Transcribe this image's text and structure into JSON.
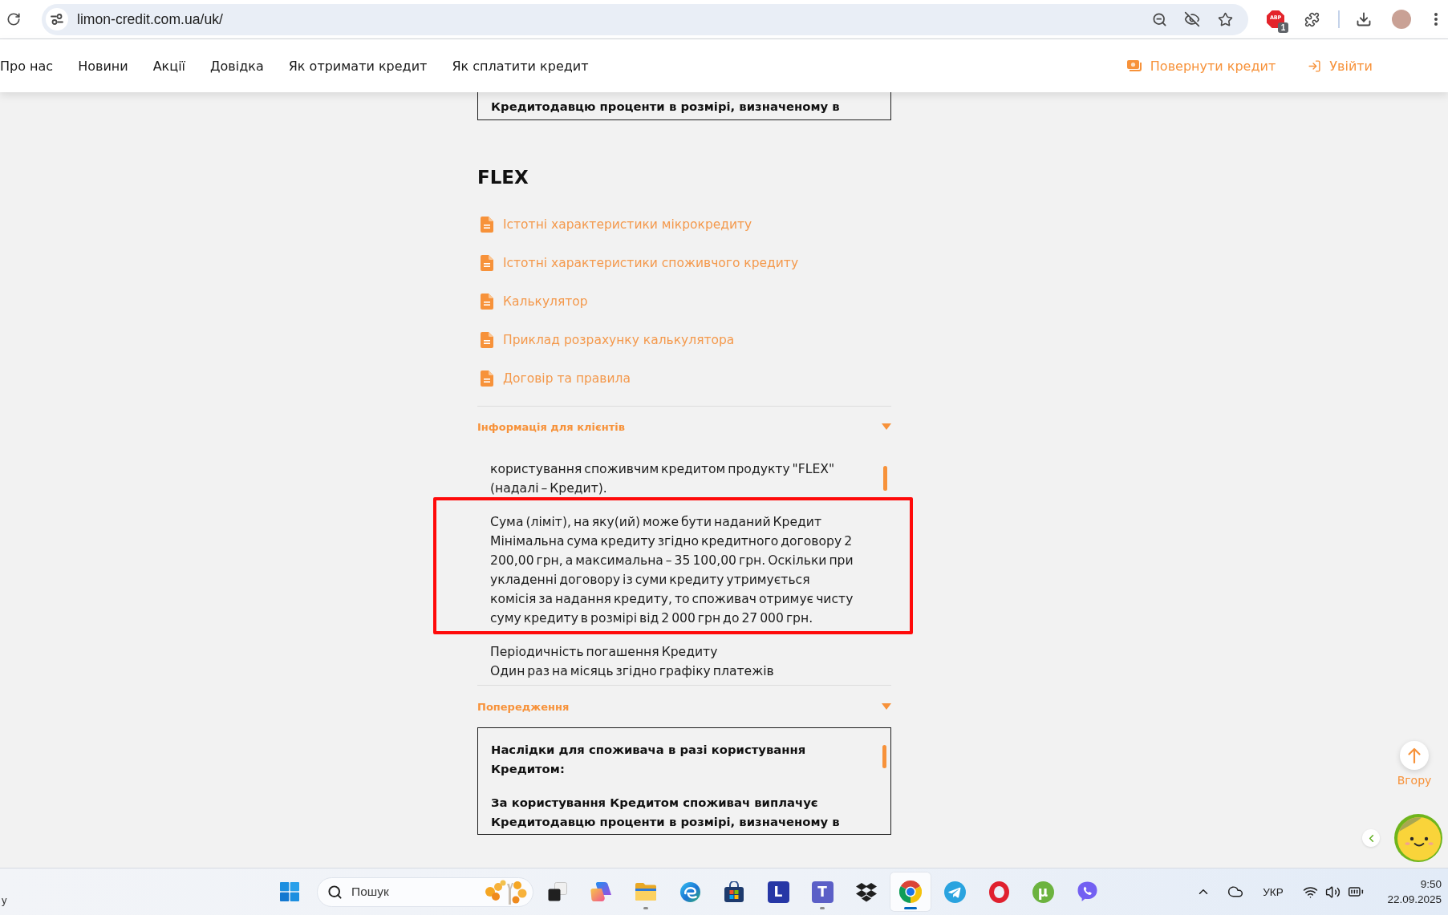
{
  "browser": {
    "url": "limon-credit.com.ua/uk/",
    "extension_label": "ABP",
    "extension_badge": "1"
  },
  "nav": {
    "items": [
      {
        "label": "Про нас"
      },
      {
        "label": "Новини"
      },
      {
        "label": "Акції"
      },
      {
        "label": "Довідка"
      },
      {
        "label": "Як отримати кредит"
      },
      {
        "label": "Як сплатити кредит"
      }
    ],
    "actions": [
      {
        "kind": "repay",
        "label": "Повернути кредит"
      },
      {
        "kind": "login",
        "label": "Увійти"
      }
    ]
  },
  "previous_box": {
    "text": "Кредитодавцю проценти в розмірі, визначеному в"
  },
  "product": {
    "title": "FLEX",
    "documents": [
      {
        "label": "Істотні характеристики мікрокредиту"
      },
      {
        "label": "Істотні характеристики споживчого кредиту"
      },
      {
        "label": "Калькулятор"
      },
      {
        "label": "Приклад розрахунку калькулятора"
      },
      {
        "label": "Договір та правила"
      }
    ]
  },
  "info_section": {
    "title": "Інформація для клієнтів",
    "expanded": true,
    "items": [
      {
        "text": "користування споживчим кредитом продукту \"FLEX\" (надалі – Кредит).",
        "highlighted": false
      },
      {
        "title": "Сума (ліміт), на яку(ий) може бути наданий Кредит",
        "text": "Мінімальна сума кредиту згідно кредитного договору 2 200,00 грн, а максимальна – 35 100,00 грн. Оскільки при укладенні договору із суми кредиту утримується комісія за надання кредиту, то споживач отримує чисту суму кредиту в розмірі від 2 000 грн до 27 000 грн.",
        "highlighted": true
      },
      {
        "title": "Періодичність погашення Кредиту",
        "text": "Один раз на місяць згідно графіку платежів",
        "highlighted": false
      }
    ]
  },
  "warning_section": {
    "title": "Попередження",
    "expanded": true,
    "paragraphs": [
      "Наслідки для споживача в разі користування Кредитом:",
      "За користування Кредитом споживач виплачує Кредитодавцю проценти в розмірі, визначеному в"
    ]
  },
  "scroll_top": {
    "label": "Вгору"
  },
  "taskbar": {
    "widget_text": "у",
    "search": {
      "placeholder": "Пошук"
    },
    "apps": [
      {
        "kind": "task-view",
        "running": false,
        "selected": false
      },
      {
        "kind": "copilot",
        "running": false,
        "selected": false
      },
      {
        "kind": "explorer",
        "running": true,
        "selected": false
      },
      {
        "kind": "edge",
        "running": false,
        "selected": false
      },
      {
        "kind": "store",
        "running": false,
        "selected": false
      },
      {
        "kind": "letter",
        "glyph": "L",
        "running": false,
        "selected": false
      },
      {
        "kind": "teams",
        "glyph": "T",
        "running": true,
        "selected": false
      },
      {
        "kind": "dropbox",
        "running": false,
        "selected": false
      },
      {
        "kind": "chrome",
        "running": true,
        "selected": true
      },
      {
        "kind": "telegram",
        "running": false,
        "selected": false
      },
      {
        "kind": "opera",
        "running": false,
        "selected": false
      },
      {
        "kind": "utorrent",
        "glyph": "µ",
        "running": false,
        "selected": false
      },
      {
        "kind": "viber",
        "running": false,
        "selected": false
      }
    ],
    "language": "УКР",
    "time": "9:50",
    "date": "22.09.2025"
  }
}
